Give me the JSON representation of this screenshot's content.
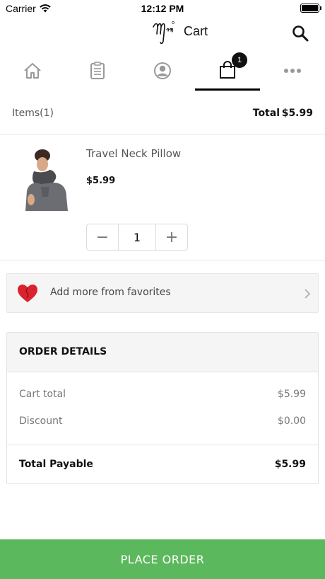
{
  "status_bar": {
    "carrier": "Carrier",
    "time": "12:12 PM"
  },
  "header": {
    "title": "Cart",
    "logo_text": "Mim"
  },
  "tabs": [
    {
      "name": "home",
      "icon": "home-icon"
    },
    {
      "name": "orders",
      "icon": "clipboard-icon"
    },
    {
      "name": "account",
      "icon": "user-icon"
    },
    {
      "name": "cart",
      "icon": "shopping-bag-icon",
      "badge": "1",
      "active": true
    },
    {
      "name": "more",
      "icon": "more-icon"
    }
  ],
  "summary": {
    "items_label": "Items(1)",
    "total_label": "Total",
    "total_value": "$5.99"
  },
  "cart_item": {
    "name": "Travel Neck Pillow",
    "price": "$5.99",
    "quantity": "1",
    "minus": "−",
    "plus": "+"
  },
  "favorites": {
    "label": "Add more from favorites"
  },
  "order_details": {
    "heading": "ORDER DETAILS",
    "cart_total_label": "Cart total",
    "cart_total_value": "$5.99",
    "discount_label": "Discount",
    "discount_value": "$0.00",
    "total_payable_label": "Total Payable",
    "total_payable_value": "$5.99"
  },
  "cta": {
    "label": "PLACE ORDER"
  },
  "colors": {
    "accent_green": "#5cb85c",
    "heart_red": "#d9232e"
  }
}
